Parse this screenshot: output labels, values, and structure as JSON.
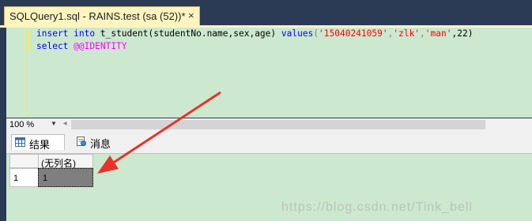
{
  "tab": {
    "title": "SQLQuery1.sql - RAINS.test (sa (52))*",
    "close_glyph": "×"
  },
  "editor": {
    "line1": {
      "kw1": "insert",
      "kw2": "into",
      "table": " t_student(studentNo.name,sex,age) ",
      "kw3": "values",
      "open": "(",
      "v1": "'15040241059'",
      "c1": ",",
      "v2": "'zlk'",
      "c2": ",",
      "v3": "'man'",
      "tail": ",22)"
    },
    "line2": {
      "kw": "select",
      "sys": "@@IDENTITY"
    }
  },
  "status": {
    "zoom": "100 %",
    "zoom_arrow": "▼",
    "scroll_left": "◂"
  },
  "results": {
    "tabs": [
      {
        "label": "结果"
      },
      {
        "label": "消息"
      }
    ],
    "column_header": "(无列名)",
    "rows": [
      {
        "row_number": "1",
        "value": "1"
      }
    ]
  },
  "watermark": "https://blog.csdn.net/Tink_bell",
  "colors": {
    "editor_bg": "#cce8cf",
    "tab_bg": "#fdf4bf",
    "arrow": "#e8322a",
    "keyword": "#0000ff",
    "string": "#ff0000",
    "system": "#ff00ff"
  }
}
